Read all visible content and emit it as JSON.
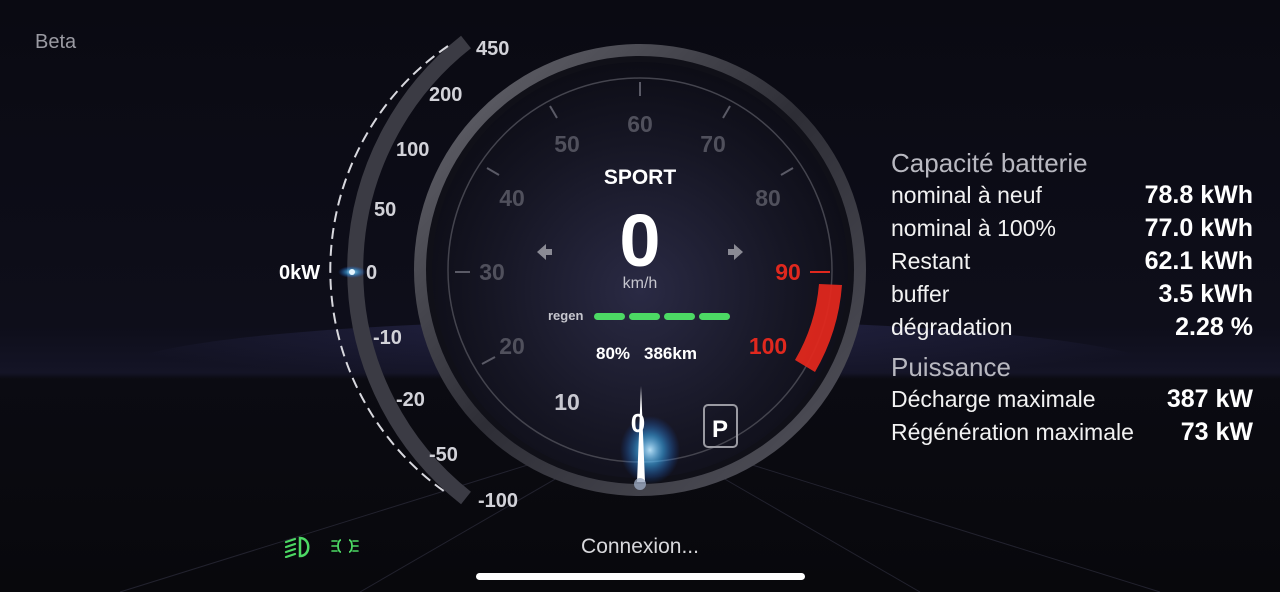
{
  "beta_label": "Beta",
  "power_gauge": {
    "ticks": [
      "450",
      "200",
      "100",
      "50",
      "0",
      "-10",
      "-20",
      "-50",
      "-100"
    ],
    "current_label": "0kW"
  },
  "speedometer": {
    "mode": "SPORT",
    "speed": "0",
    "unit": "km/h",
    "scale": [
      "10",
      "20",
      "30",
      "40",
      "50",
      "60",
      "70",
      "80",
      "90",
      "100"
    ],
    "needle_value": "0",
    "regen_label": "regen",
    "regen_segments": 4,
    "battery_percent": "80%",
    "range": "386km",
    "gear": "P",
    "accent_color": "#e0281e",
    "regen_color": "#4cd964"
  },
  "battery": {
    "title": "Capacité batterie",
    "rows": [
      {
        "label": "nominal à neuf",
        "value": "78.8 kWh"
      },
      {
        "label": "nominal à 100%",
        "value": "77.0 kWh"
      },
      {
        "label": "Restant",
        "value": "62.1 kWh"
      },
      {
        "label": "buffer",
        "value": "3.5 kWh"
      },
      {
        "label": "dégradation",
        "value": "2.28 %"
      }
    ]
  },
  "power": {
    "title": "Puissance",
    "rows": [
      {
        "label": "Décharge maximale",
        "value": "387 kW"
      },
      {
        "label": "Régénération maximale",
        "value": "73 kW"
      }
    ]
  },
  "indicators": {
    "low_beam_icon": "low-beam-headlight-icon",
    "parking_lights_icon": "parking-lights-icon",
    "color": "#4cd964"
  },
  "status_text": "Connexion..."
}
